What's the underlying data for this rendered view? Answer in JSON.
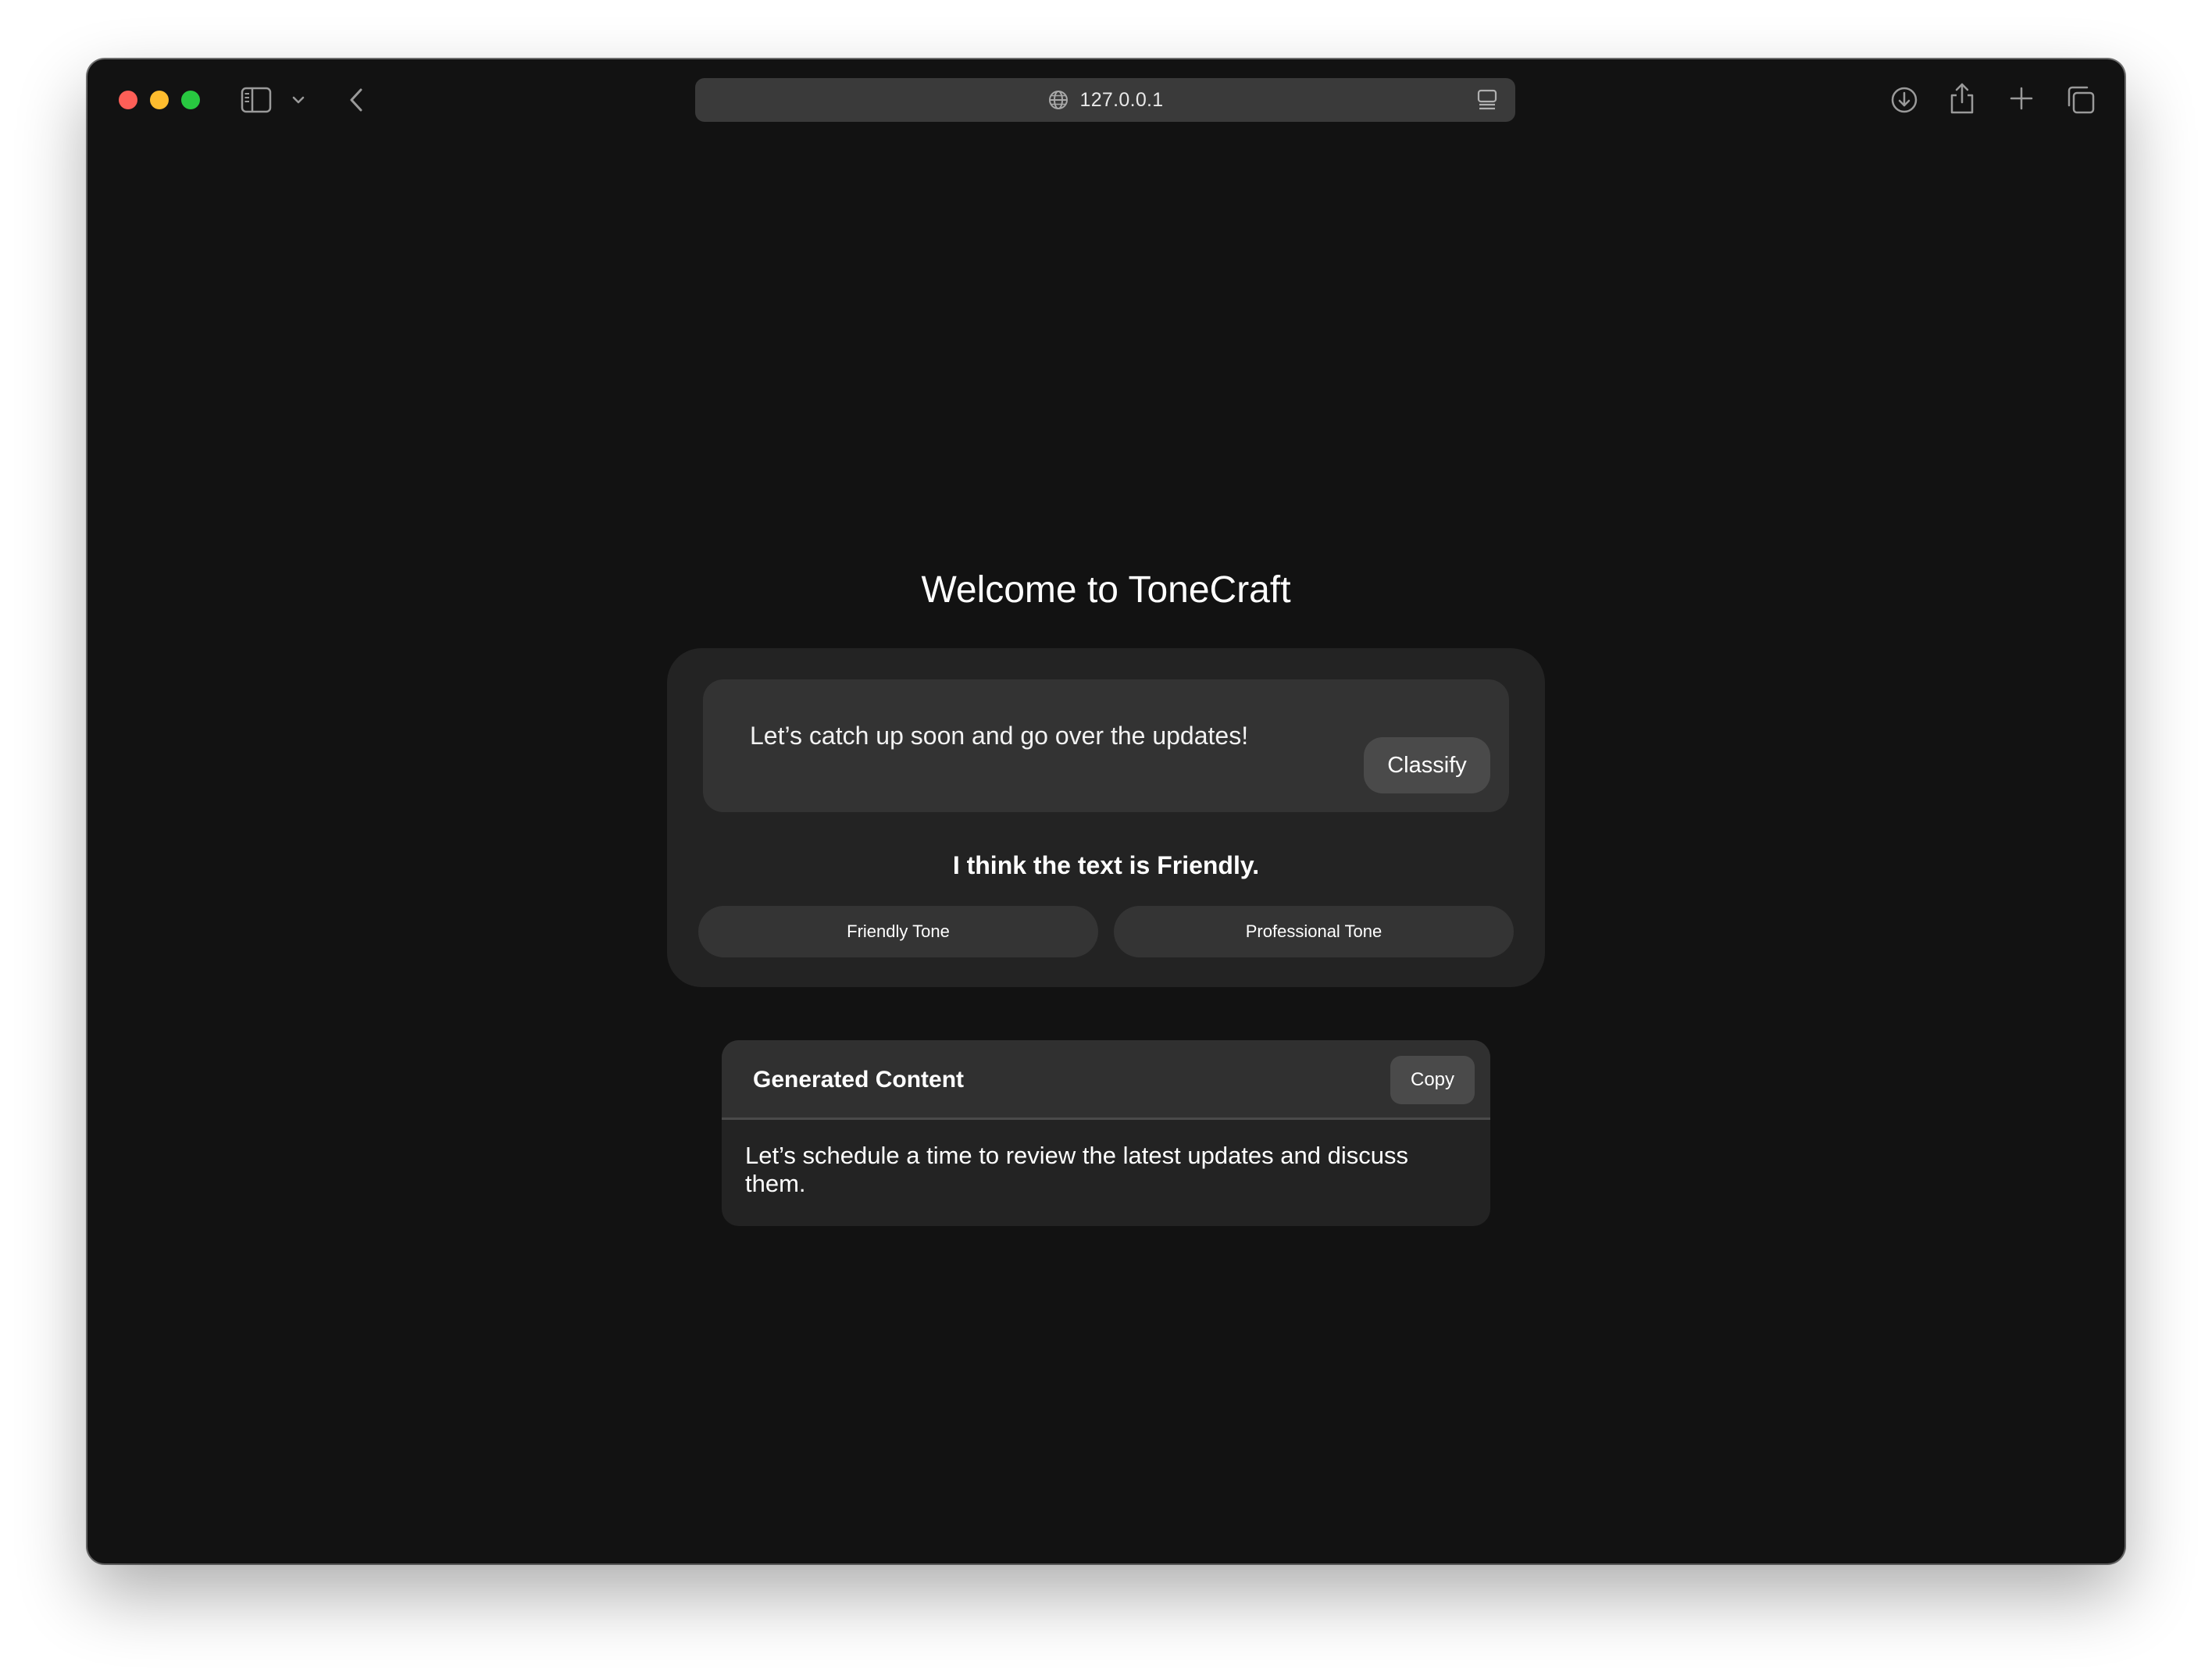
{
  "browser": {
    "url": "127.0.0.1",
    "icons": {
      "sidebar": "sidebar-icon",
      "chevron": "chevron-down-icon",
      "back": "chevron-left-icon",
      "globe": "globe-icon",
      "reader": "reader-icon",
      "download": "download-icon",
      "share": "share-icon",
      "new_tab": "plus-icon",
      "tabs": "tabs-overview-icon"
    },
    "traffic_lights": {
      "close": "#fe5f57",
      "minimize": "#febc2e",
      "maximize": "#28c840"
    }
  },
  "page": {
    "title": "Welcome to ToneCraft",
    "input": {
      "value": "Let’s catch up soon and go over the updates!"
    },
    "classify_label": "Classify",
    "result": "I think the text is Friendly.",
    "tone_buttons": {
      "friendly": "Friendly Tone",
      "professional": "Professional Tone"
    },
    "generated": {
      "title": "Generated Content",
      "copy_label": "Copy",
      "body": "Let’s schedule a time to review the latest updates and discuss them."
    }
  },
  "colors": {
    "window_bg": "#121212",
    "card_bg": "#232323",
    "input_bg": "#333333",
    "button_bg": "#4a4a4a",
    "text": "#ffffff"
  }
}
